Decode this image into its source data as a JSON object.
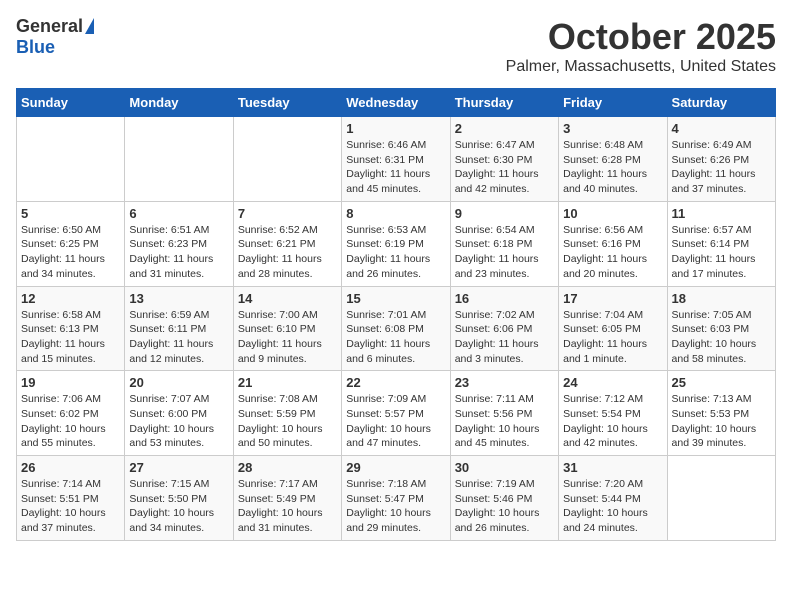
{
  "header": {
    "logo_general": "General",
    "logo_blue": "Blue",
    "month": "October 2025",
    "location": "Palmer, Massachusetts, United States"
  },
  "days_of_week": [
    "Sunday",
    "Monday",
    "Tuesday",
    "Wednesday",
    "Thursday",
    "Friday",
    "Saturday"
  ],
  "weeks": [
    [
      {
        "day": "",
        "info": ""
      },
      {
        "day": "",
        "info": ""
      },
      {
        "day": "",
        "info": ""
      },
      {
        "day": "1",
        "info": "Sunrise: 6:46 AM\nSunset: 6:31 PM\nDaylight: 11 hours and 45 minutes."
      },
      {
        "day": "2",
        "info": "Sunrise: 6:47 AM\nSunset: 6:30 PM\nDaylight: 11 hours and 42 minutes."
      },
      {
        "day": "3",
        "info": "Sunrise: 6:48 AM\nSunset: 6:28 PM\nDaylight: 11 hours and 40 minutes."
      },
      {
        "day": "4",
        "info": "Sunrise: 6:49 AM\nSunset: 6:26 PM\nDaylight: 11 hours and 37 minutes."
      }
    ],
    [
      {
        "day": "5",
        "info": "Sunrise: 6:50 AM\nSunset: 6:25 PM\nDaylight: 11 hours and 34 minutes."
      },
      {
        "day": "6",
        "info": "Sunrise: 6:51 AM\nSunset: 6:23 PM\nDaylight: 11 hours and 31 minutes."
      },
      {
        "day": "7",
        "info": "Sunrise: 6:52 AM\nSunset: 6:21 PM\nDaylight: 11 hours and 28 minutes."
      },
      {
        "day": "8",
        "info": "Sunrise: 6:53 AM\nSunset: 6:19 PM\nDaylight: 11 hours and 26 minutes."
      },
      {
        "day": "9",
        "info": "Sunrise: 6:54 AM\nSunset: 6:18 PM\nDaylight: 11 hours and 23 minutes."
      },
      {
        "day": "10",
        "info": "Sunrise: 6:56 AM\nSunset: 6:16 PM\nDaylight: 11 hours and 20 minutes."
      },
      {
        "day": "11",
        "info": "Sunrise: 6:57 AM\nSunset: 6:14 PM\nDaylight: 11 hours and 17 minutes."
      }
    ],
    [
      {
        "day": "12",
        "info": "Sunrise: 6:58 AM\nSunset: 6:13 PM\nDaylight: 11 hours and 15 minutes."
      },
      {
        "day": "13",
        "info": "Sunrise: 6:59 AM\nSunset: 6:11 PM\nDaylight: 11 hours and 12 minutes."
      },
      {
        "day": "14",
        "info": "Sunrise: 7:00 AM\nSunset: 6:10 PM\nDaylight: 11 hours and 9 minutes."
      },
      {
        "day": "15",
        "info": "Sunrise: 7:01 AM\nSunset: 6:08 PM\nDaylight: 11 hours and 6 minutes."
      },
      {
        "day": "16",
        "info": "Sunrise: 7:02 AM\nSunset: 6:06 PM\nDaylight: 11 hours and 3 minutes."
      },
      {
        "day": "17",
        "info": "Sunrise: 7:04 AM\nSunset: 6:05 PM\nDaylight: 11 hours and 1 minute."
      },
      {
        "day": "18",
        "info": "Sunrise: 7:05 AM\nSunset: 6:03 PM\nDaylight: 10 hours and 58 minutes."
      }
    ],
    [
      {
        "day": "19",
        "info": "Sunrise: 7:06 AM\nSunset: 6:02 PM\nDaylight: 10 hours and 55 minutes."
      },
      {
        "day": "20",
        "info": "Sunrise: 7:07 AM\nSunset: 6:00 PM\nDaylight: 10 hours and 53 minutes."
      },
      {
        "day": "21",
        "info": "Sunrise: 7:08 AM\nSunset: 5:59 PM\nDaylight: 10 hours and 50 minutes."
      },
      {
        "day": "22",
        "info": "Sunrise: 7:09 AM\nSunset: 5:57 PM\nDaylight: 10 hours and 47 minutes."
      },
      {
        "day": "23",
        "info": "Sunrise: 7:11 AM\nSunset: 5:56 PM\nDaylight: 10 hours and 45 minutes."
      },
      {
        "day": "24",
        "info": "Sunrise: 7:12 AM\nSunset: 5:54 PM\nDaylight: 10 hours and 42 minutes."
      },
      {
        "day": "25",
        "info": "Sunrise: 7:13 AM\nSunset: 5:53 PM\nDaylight: 10 hours and 39 minutes."
      }
    ],
    [
      {
        "day": "26",
        "info": "Sunrise: 7:14 AM\nSunset: 5:51 PM\nDaylight: 10 hours and 37 minutes."
      },
      {
        "day": "27",
        "info": "Sunrise: 7:15 AM\nSunset: 5:50 PM\nDaylight: 10 hours and 34 minutes."
      },
      {
        "day": "28",
        "info": "Sunrise: 7:17 AM\nSunset: 5:49 PM\nDaylight: 10 hours and 31 minutes."
      },
      {
        "day": "29",
        "info": "Sunrise: 7:18 AM\nSunset: 5:47 PM\nDaylight: 10 hours and 29 minutes."
      },
      {
        "day": "30",
        "info": "Sunrise: 7:19 AM\nSunset: 5:46 PM\nDaylight: 10 hours and 26 minutes."
      },
      {
        "day": "31",
        "info": "Sunrise: 7:20 AM\nSunset: 5:44 PM\nDaylight: 10 hours and 24 minutes."
      },
      {
        "day": "",
        "info": ""
      }
    ]
  ]
}
